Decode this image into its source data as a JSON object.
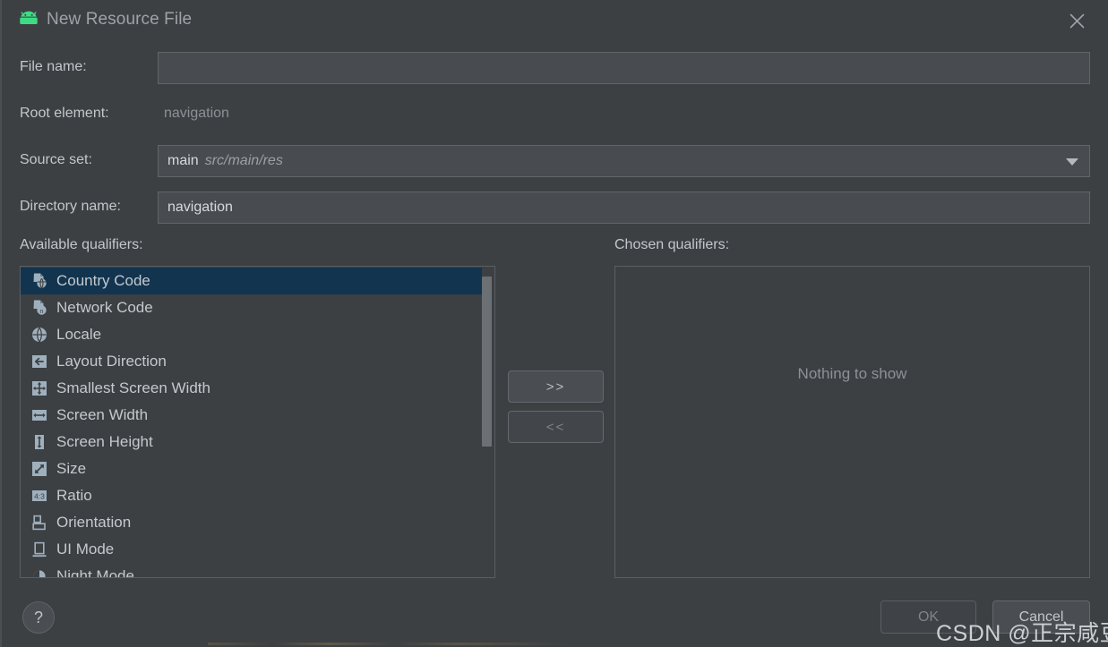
{
  "window": {
    "title": "New Resource File",
    "icon": "android-robot-icon",
    "close_icon": "close-icon"
  },
  "form": {
    "file_name": {
      "label": "File name:",
      "value": "",
      "placeholder": ""
    },
    "root_element": {
      "label": "Root element:",
      "value": "navigation"
    },
    "source_set": {
      "label": "Source set:",
      "value": "main",
      "path": "src/main/res",
      "arrow_icon": "chevron-down-icon"
    },
    "directory_name": {
      "label": "Directory name:",
      "value": "navigation"
    }
  },
  "qualifiers": {
    "available_label": "Available qualifiers:",
    "chosen_label": "Chosen qualifiers:",
    "chosen_empty_text": "Nothing to show",
    "add_button": ">>",
    "remove_button": "<<",
    "available_items": [
      {
        "label": "Country Code",
        "icon": "country-code-icon",
        "selected": true
      },
      {
        "label": "Network Code",
        "icon": "network-code-icon",
        "selected": false
      },
      {
        "label": "Locale",
        "icon": "globe-icon",
        "selected": false
      },
      {
        "label": "Layout Direction",
        "icon": "arrow-left-icon",
        "selected": false
      },
      {
        "label": "Smallest Screen Width",
        "icon": "four-way-arrows-icon",
        "selected": false
      },
      {
        "label": "Screen Width",
        "icon": "horizontal-arrows-icon",
        "selected": false
      },
      {
        "label": "Screen Height",
        "icon": "vertical-arrows-icon",
        "selected": false
      },
      {
        "label": "Size",
        "icon": "diagonal-arrow-icon",
        "selected": false
      },
      {
        "label": "Ratio",
        "icon": "ratio-43-icon",
        "selected": false
      },
      {
        "label": "Orientation",
        "icon": "orientation-icon",
        "selected": false
      },
      {
        "label": "UI Mode",
        "icon": "ui-mode-icon",
        "selected": false
      },
      {
        "label": "Night Mode",
        "icon": "night-mode-icon",
        "selected": false
      }
    ],
    "chosen_items": []
  },
  "footer": {
    "help_label": "?",
    "ok_label": "OK",
    "cancel_label": "Cancel"
  },
  "watermark": {
    "text": "CSDN @正宗咸豆花"
  },
  "colors": {
    "background": "#3c4043",
    "field_background": "#484c50",
    "selection": "#12344f",
    "text": "#c2c7cc",
    "muted_text": "#8c9197",
    "android_green": "#3ddc84",
    "icon_blue_grey": "#9fb0bd"
  }
}
